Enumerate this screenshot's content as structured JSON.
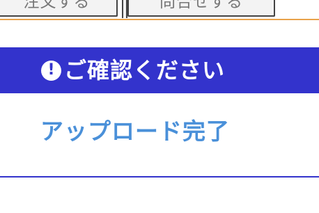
{
  "tabs": [
    {
      "label": "注文する"
    },
    {
      "label": "問合せする"
    }
  ],
  "notice": {
    "icon": "exclamation-circle-icon",
    "title": "ご確認ください"
  },
  "message": {
    "text": "アップロード完了"
  },
  "colors": {
    "banner": "#3333cc",
    "message": "#4a90d9",
    "tab_underline": "#e8a24a"
  }
}
